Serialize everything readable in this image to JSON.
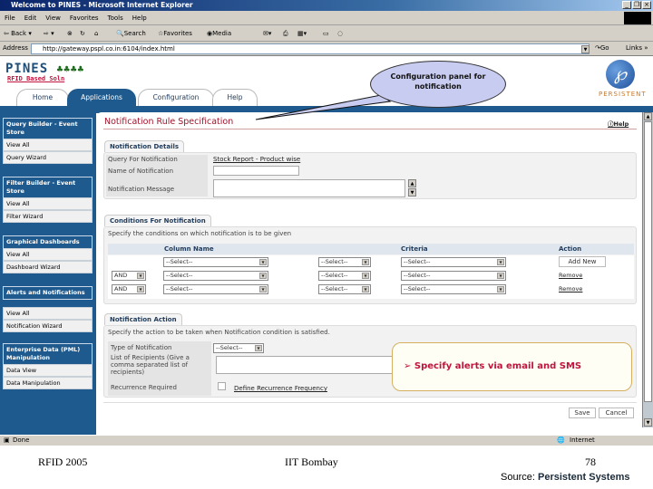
{
  "window": {
    "title": "Welcome to PINES - Microsoft Internet Explorer"
  },
  "menu": [
    "File",
    "Edit",
    "View",
    "Favorites",
    "Tools",
    "Help"
  ],
  "toolbar": {
    "back": "Back",
    "search": "Search",
    "favorites": "Favorites",
    "media": "Media"
  },
  "address": {
    "label": "Address",
    "url": "http://gateway.pspl.co.in:6104/index.html",
    "go": "Go",
    "links": "Links"
  },
  "brand": {
    "name": "PINES",
    "subtitle": "RFID Based Soln",
    "partner": "PERSISTENT"
  },
  "tabs": [
    {
      "label": "Home"
    },
    {
      "label": "Applications"
    },
    {
      "label": "Configuration"
    },
    {
      "label": "Help"
    }
  ],
  "sidebar": [
    {
      "header": "Query Builder - Event Store",
      "items": [
        "View All",
        "Query Wizard"
      ]
    },
    {
      "header": "Filter Builder - Event Store",
      "items": [
        "View All",
        "Filter Wizard"
      ]
    },
    {
      "header": "Graphical Dashboards",
      "items": [
        "View All",
        "Dashboard Wizard"
      ]
    },
    {
      "header": "Alerts and Notifications",
      "items": [
        "View All",
        "Notification Wizard"
      ]
    },
    {
      "header": "Enterprise Data (PML) Manipulation",
      "items": [
        "Data View",
        "Data Manipulation"
      ]
    }
  ],
  "page": {
    "title": "Notification Rule Specification",
    "help": "Help"
  },
  "details": {
    "tab": "Notification Details",
    "query_label": "Query For Notification",
    "query_value": "Stock Report - Product wise",
    "name_label": "Name of Notification",
    "name_value": "",
    "message_label": "Notification Message",
    "message_value": ""
  },
  "conditions": {
    "tab": "Conditions For Notification",
    "desc": "Specify the conditions on which notification is to be given",
    "headers": [
      "Column Name",
      "Criteria",
      "Action"
    ],
    "rows": [
      {
        "op": "",
        "column": "--Select--",
        "mid": "--Select--",
        "criteria": "--Select--",
        "action": "Add New"
      },
      {
        "op": "AND",
        "column": "--Select--",
        "mid": "--Select--",
        "criteria": "--Select--",
        "action": "Remove"
      },
      {
        "op": "AND",
        "column": "--Select--",
        "mid": "--Select--",
        "criteria": "--Select--",
        "action": "Remove"
      }
    ]
  },
  "action": {
    "tab": "Notification Action",
    "desc": "Specify the action to be taken when Notification condition is satisfied.",
    "type_label": "Type of Notification",
    "type_value": "--Select--",
    "recipients_label": "List of Recipients (Give a comma separated list of recipients)",
    "recurrence_label": "Recurrence Required",
    "recurrence_link": "Define Recurrence Frequency"
  },
  "buttons": {
    "save": "Save",
    "cancel": "Cancel"
  },
  "callout": "Configuration panel for notification",
  "note": "➢ Specify alerts via email and SMS",
  "status": {
    "left": "Done",
    "zone": "Internet"
  },
  "footer": {
    "left": "RFID 2005",
    "center": "IIT Bombay",
    "page": "78",
    "source_label": "Source:",
    "source": "Persistent Systems"
  }
}
